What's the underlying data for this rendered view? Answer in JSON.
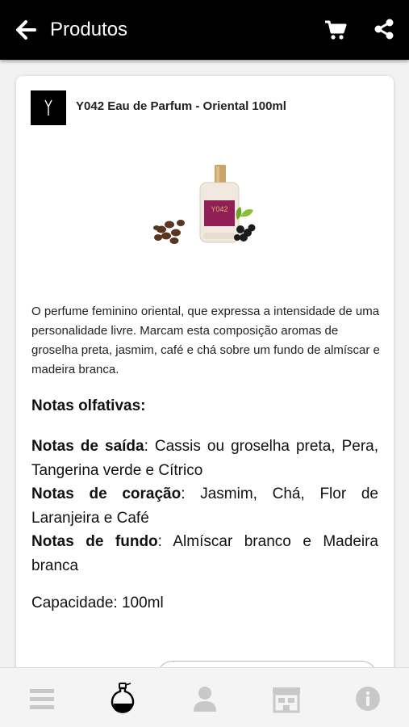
{
  "header": {
    "title": "Produtos",
    "back_icon": "arrow-left-icon",
    "cart_icon": "shopping-cart-icon",
    "share_icon": "share-icon"
  },
  "product": {
    "title": "Y042 Eau de Parfum - Oriental 100ml",
    "bottle_label": "Y042",
    "description": "O perfume feminino oriental, que expressa a intensidade de uma personalidade livre. Marcam esta composição aromas de groselha preta, jasmim, café e chá sobre um fundo de almíscar e madeira branca.",
    "notes_heading": "Notas olfativas:",
    "notes": [
      {
        "label": "Notas de saída",
        "value": ": Cassis ou groselha preta, Pera, Tangerina verde e Cítrico"
      },
      {
        "label": "Notas de coração",
        "value": ": Jasmim, Chá, Flor de Laranjeira e Café"
      },
      {
        "label": "Notas de fundo",
        "value": ": Almíscar branco e Madeira branca"
      }
    ],
    "capacity": "Capacidade: 100ml"
  },
  "bottom_nav": [
    {
      "icon": "menu-icon",
      "active": false
    },
    {
      "icon": "perfume-bottle-icon",
      "active": true
    },
    {
      "icon": "user-icon",
      "active": false
    },
    {
      "icon": "store-icon",
      "active": false
    },
    {
      "icon": "info-icon",
      "active": false
    }
  ],
  "colors": {
    "header_bg": "#000000",
    "inactive_icon": "#c8c8c8",
    "active_icon": "#000000"
  }
}
